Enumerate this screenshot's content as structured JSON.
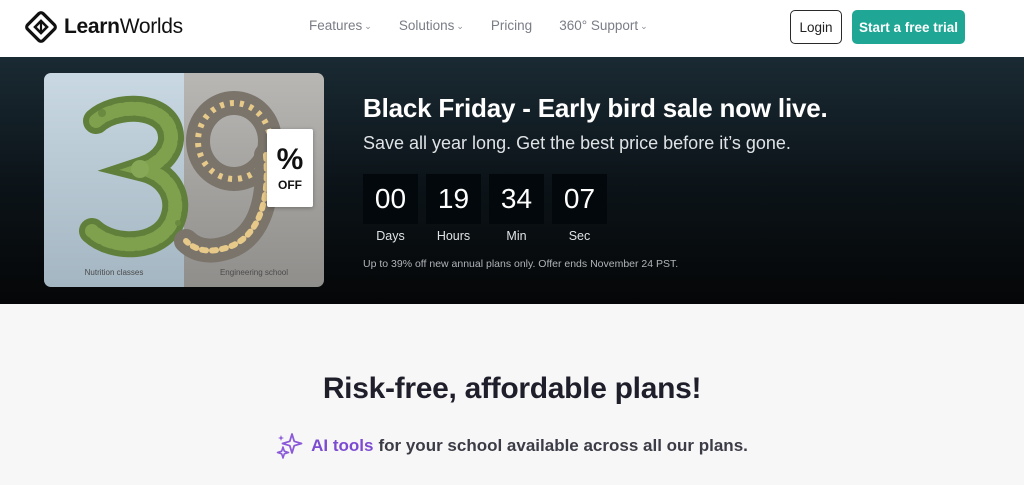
{
  "brand": {
    "name_bold": "Learn",
    "name_regular": "Worlds",
    "logo_icon": "learnworlds-diamond-logo"
  },
  "nav": {
    "items": [
      {
        "label": "Features",
        "has_dropdown": true
      },
      {
        "label": "Solutions",
        "has_dropdown": true
      },
      {
        "label": "Pricing",
        "has_dropdown": false
      },
      {
        "label": "360° Support",
        "has_dropdown": true
      }
    ],
    "dropdown_icon": "chevron-down-icon",
    "login_label": "Login",
    "trial_label": "Start a free trial"
  },
  "hero": {
    "title": "Black Friday - Early bird sale now live.",
    "subtitle": "Save all year long. Get the best price before it’s gone.",
    "promo_image": {
      "left_caption": "Nutrition classes",
      "right_caption": "Engineering school",
      "percent_sign": "%",
      "off_label": "OFF"
    },
    "countdown": [
      {
        "value": "00",
        "label": "Days"
      },
      {
        "value": "19",
        "label": "Hours"
      },
      {
        "value": "34",
        "label": "Min"
      },
      {
        "value": "07",
        "label": "Sec"
      }
    ],
    "note": "Up to 39% off new annual plans only. Offer ends November 24 PST."
  },
  "plans": {
    "title": "Risk-free, affordable plans!",
    "ai_icon": "sparkle-icon",
    "ai_link_label": "AI tools",
    "ai_rest_text": "for your school available across all our plans."
  },
  "colors": {
    "accent": "#1fa694",
    "ai_purple": "#7c4bd1",
    "hero_bg": "#0c1419"
  }
}
